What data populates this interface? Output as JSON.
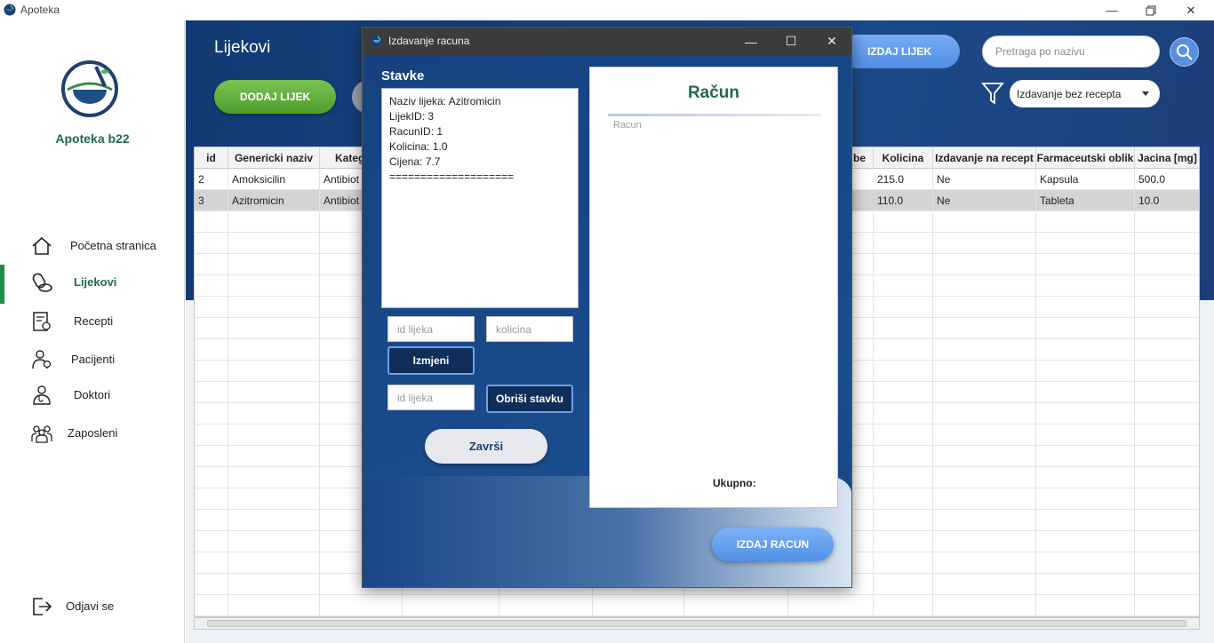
{
  "window": {
    "title": "Apoteka",
    "icon": "mortar-pestle-icon"
  },
  "sidebar": {
    "brand": "Apoteka b22",
    "items": [
      {
        "label": "Početna stranica",
        "icon": "home-icon"
      },
      {
        "label": "Lijekovi",
        "icon": "pills-icon",
        "active": true
      },
      {
        "label": "Recepti",
        "icon": "prescription-icon"
      },
      {
        "label": "Pacijenti",
        "icon": "patient-icon"
      },
      {
        "label": "Doktori",
        "icon": "doctor-icon"
      },
      {
        "label": "Zaposleni",
        "icon": "team-icon"
      }
    ],
    "logout": {
      "label": "Odjavi se",
      "icon": "logout-icon"
    }
  },
  "main": {
    "title": "Lijekovi",
    "add_button": "DODAJ LIJEK",
    "issue_button": "IZDAJ LIJEK",
    "search_placeholder": "Pretraga po nazivu",
    "filter_value": "Izdavanje bez recepta"
  },
  "table": {
    "columns": [
      "id",
      "Genericki naziv",
      "Kateg",
      "be",
      "Kolicina",
      "Izdavanje na recept",
      "Farmaceutski oblik",
      "Jacina [mg]"
    ],
    "rows": [
      [
        "2",
        "Amoksicilin",
        "Antibiot",
        "",
        "215.0",
        "Ne",
        "Kapsula",
        "500.0"
      ],
      [
        "3",
        "Azitromicin",
        "Antibiot",
        "",
        "110.0",
        "Ne",
        "Tableta",
        "10.0"
      ]
    ]
  },
  "dialog": {
    "title": "Izdavanje racuna",
    "stavke_label": "Stavke",
    "stavke_text": "Naziv lijeka: Azitromicin\nLijekID: 3\nRacunID: 1\nKolicina: 1.0\nCijena: 7.7\n====================",
    "id_placeholder": "id lijeka",
    "kolicina_placeholder": "kolicina",
    "izmijeni": "Izmjeni",
    "id_placeholder_2": "id lijeka",
    "obrisi": "Obriši stavku",
    "zavrsi": "Završi",
    "racun_title": "Račun",
    "racun_placeholder": "Racun",
    "ukupno": "Ukupno:",
    "izdaj_racun": "IZDAJ RACUN"
  }
}
